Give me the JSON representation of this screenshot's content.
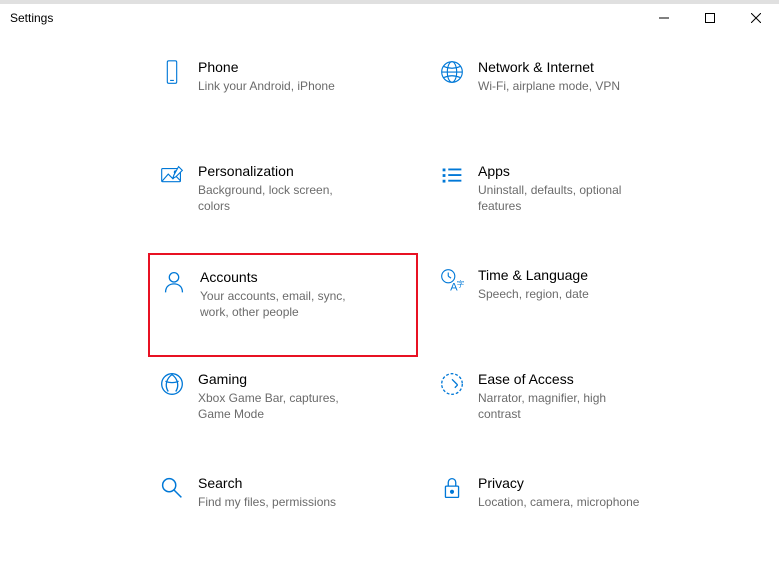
{
  "window": {
    "title": "Settings"
  },
  "tiles": {
    "phone": {
      "title": "Phone",
      "sub": "Link your Android, iPhone"
    },
    "network": {
      "title": "Network & Internet",
      "sub": "Wi-Fi, airplane mode, VPN"
    },
    "personal": {
      "title": "Personalization",
      "sub": "Background, lock screen, colors"
    },
    "apps": {
      "title": "Apps",
      "sub": "Uninstall, defaults, optional features"
    },
    "accounts": {
      "title": "Accounts",
      "sub": "Your accounts, email, sync, work, other people"
    },
    "time": {
      "title": "Time & Language",
      "sub": "Speech, region, date"
    },
    "gaming": {
      "title": "Gaming",
      "sub": "Xbox Game Bar, captures, Game Mode"
    },
    "ease": {
      "title": "Ease of Access",
      "sub": "Narrator, magnifier, high contrast"
    },
    "search": {
      "title": "Search",
      "sub": "Find my files, permissions"
    },
    "privacy": {
      "title": "Privacy",
      "sub": "Location, camera, microphone"
    }
  }
}
